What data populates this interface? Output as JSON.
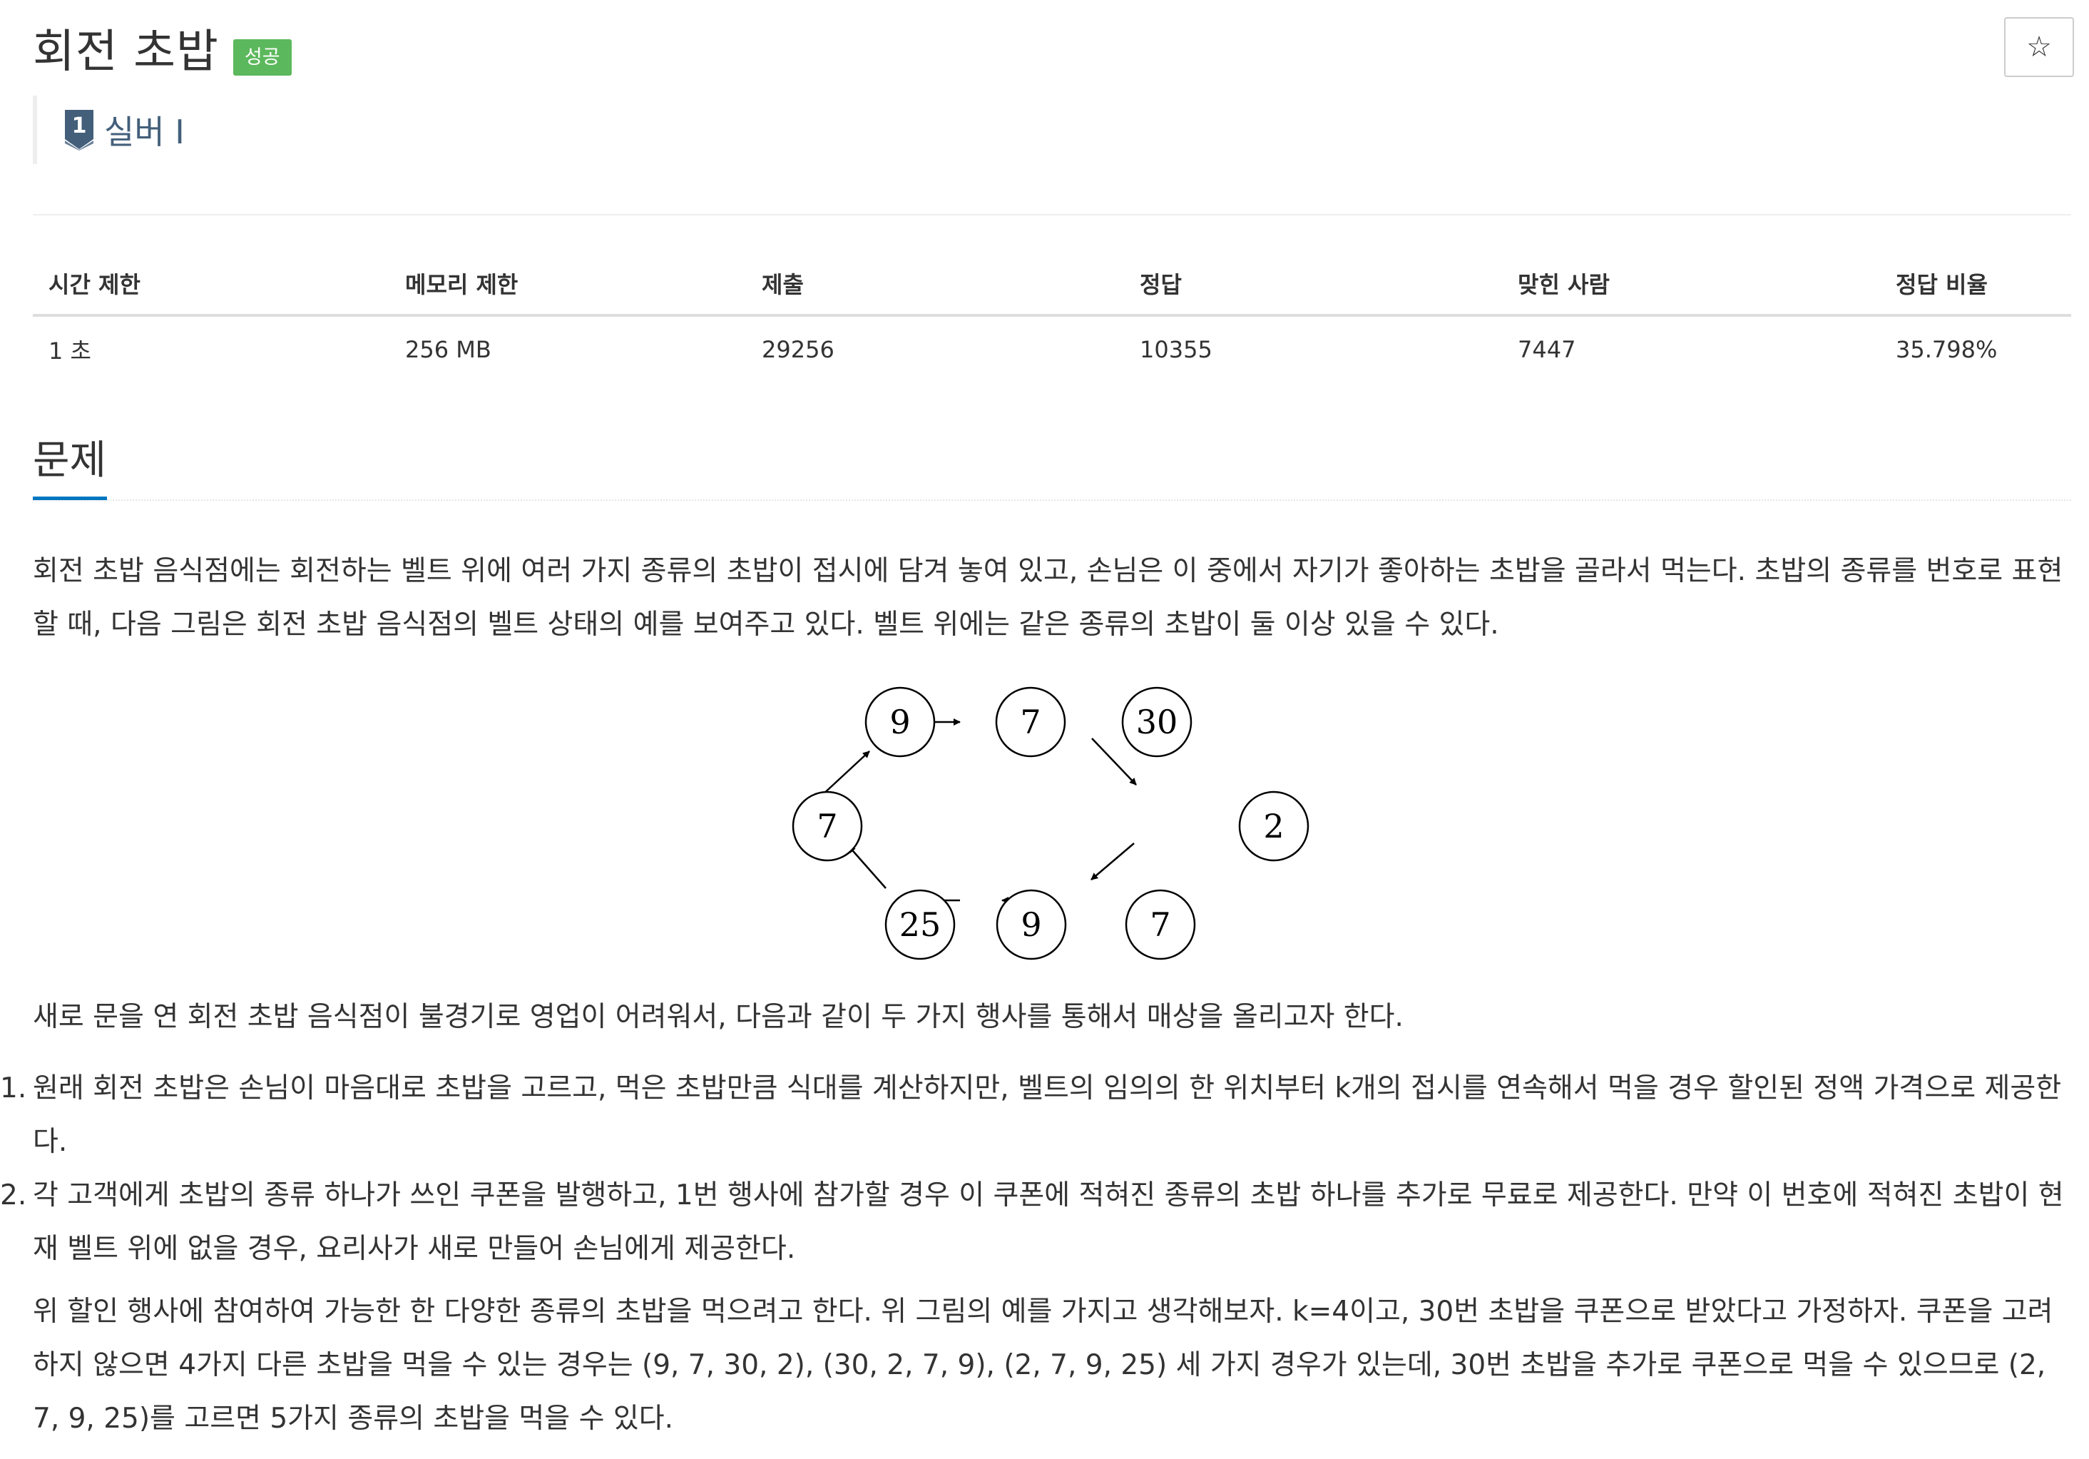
{
  "problem": {
    "title": "회전 초밥",
    "status_badge": "성공",
    "tier_label": "실버 I",
    "tier_number": "1",
    "star_icon": "☆"
  },
  "info_table": {
    "headers": [
      "시간 제한",
      "메모리 제한",
      "제출",
      "정답",
      "맞힌 사람",
      "정답 비율"
    ],
    "values": [
      "1 초",
      "256 MB",
      "29256",
      "10355",
      "7447",
      "35.798%"
    ]
  },
  "section": {
    "title": "문제"
  },
  "content": {
    "p1": "회전 초밥 음식점에는 회전하는 벨트 위에 여러 가지 종류의 초밥이 접시에 담겨 놓여 있고, 손님은 이 중에서 자기가 좋아하는 초밥을 골라서 먹는다. 초밥의 종류를 번호로 표현할 때, 다음 그림은 회전 초밥 음식점의 벨트 상태의 예를 보여주고 있다. 벨트 위에는 같은 종류의 초밥이 둘 이상 있을 수 있다.",
    "p2": "새로 문을 연 회전 초밥 음식점이 불경기로 영업이 어려워서, 다음과 같이 두 가지 행사를 통해서 매상을 올리고자 한다.",
    "list": [
      {
        "num": "1.",
        "text": "원래 회전 초밥은 손님이 마음대로 초밥을 고르고, 먹은 초밥만큼 식대를 계산하지만, 벨트의 임의의 한 위치부터 k개의 접시를 연속해서 먹을 경우 할인된 정액 가격으로 제공한다."
      },
      {
        "num": "2.",
        "text": "각 고객에게 초밥의 종류 하나가 쓰인 쿠폰을 발행하고, 1번 행사에 참가할 경우 이 쿠폰에 적혀진 종류의 초밥 하나를 추가로 무료로 제공한다. 만약 이 번호에 적혀진 초밥이 현재 벨트 위에 없을 경우, 요리사가 새로 만들어 손님에게 제공한다."
      }
    ],
    "p3": "위 할인 행사에 참여하여 가능한 한 다양한 종류의 초밥을 먹으려고 한다. 위 그림의 예를 가지고 생각해보자. k=4이고, 30번 초밥을 쿠폰으로 받았다고 가정하자. 쿠폰을 고려하지 않으면 4가지 다른 초밥을 먹을 수 있는 경우는 (9, 7, 30, 2), (30, 2, 7, 9), (2, 7, 9, 25) 세 가지 경우가 있는데, 30번 초밥을 추가로 쿠폰으로 먹을 수 있으므로 (2, 7, 9, 25)를 고르면 5가지 종류의 초밥을 먹을 수 있다."
  },
  "belt_diagram": {
    "nodes": [
      "9",
      "7",
      "30",
      "2",
      "7",
      "9",
      "25",
      "7"
    ]
  }
}
